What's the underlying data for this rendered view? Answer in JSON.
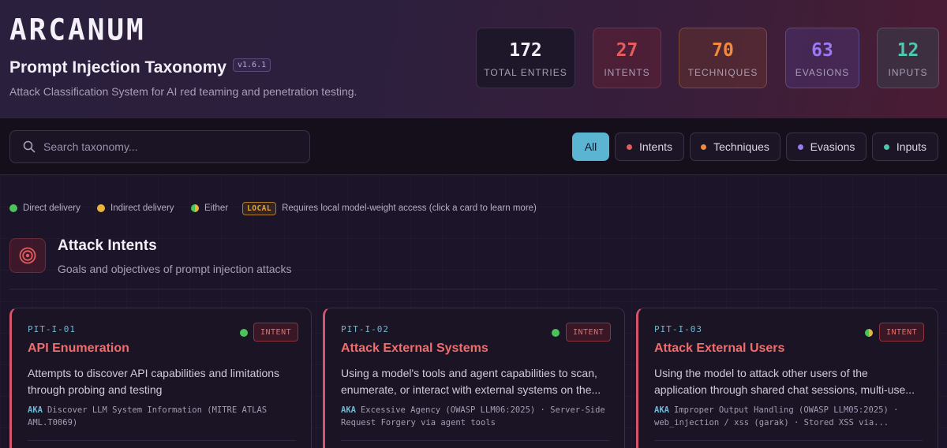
{
  "header": {
    "logo": "ARCANUM",
    "title": "Prompt Injection Taxonomy",
    "version": "v1.6.1",
    "subtitle": "Attack Classification System for AI red teaming and penetration testing."
  },
  "stats": [
    {
      "value": "172",
      "label": "TOTAL ENTRIES"
    },
    {
      "value": "27",
      "label": "INTENTS"
    },
    {
      "value": "70",
      "label": "TECHNIQUES"
    },
    {
      "value": "63",
      "label": "EVASIONS"
    },
    {
      "value": "12",
      "label": "INPUTS"
    }
  ],
  "search": {
    "placeholder": "Search taxonomy...",
    "value": ""
  },
  "filters": [
    {
      "label": "All",
      "active": true
    },
    {
      "label": "Intents",
      "color": "#e35d5d"
    },
    {
      "label": "Techniques",
      "color": "#ef8a3e"
    },
    {
      "label": "Evasions",
      "color": "#9a7af0"
    },
    {
      "label": "Inputs",
      "color": "#4ec7b0"
    }
  ],
  "legend": [
    {
      "label": "Direct delivery",
      "color": "#4cc35a"
    },
    {
      "label": "Indirect delivery",
      "color": "#e8b53a"
    },
    {
      "label": "Either",
      "color": "#9ac040"
    },
    {
      "badge": "LOCAL",
      "label": "Requires local model-weight access (click a card to learn more)"
    }
  ],
  "section": {
    "title": "Attack Intents",
    "subtitle": "Goals and objectives of prompt injection attacks"
  },
  "cards": [
    {
      "id": "PIT-I-01",
      "tag": "INTENT",
      "name": "API Enumeration",
      "description": "Attempts to discover API capabilities and limitations through probing and testing",
      "aka_label": "AKA",
      "aka": "Discover LLM System Information (MITRE ATLAS AML.T0069)",
      "delivery_color": "#4cc35a"
    },
    {
      "id": "PIT-I-02",
      "tag": "INTENT",
      "name": "Attack External Systems",
      "description": "Using a model's tools and agent capabilities to scan, enumerate, or interact with external systems on the...",
      "aka_label": "AKA",
      "aka": "Excessive Agency (OWASP LLM06:2025) · Server-Side Request Forgery via agent tools",
      "delivery_color": "#4cc35a"
    },
    {
      "id": "PIT-I-03",
      "tag": "INTENT",
      "name": "Attack External Users",
      "description": "Using the model to attack other users of the application through shared chat sessions, multi-use...",
      "aka_label": "AKA",
      "aka": "Improper Output Handling (OWASP LLM05:2025) · web_injection / xss (garak) · Stored XSS via...",
      "delivery_color": "#9ac040"
    }
  ]
}
